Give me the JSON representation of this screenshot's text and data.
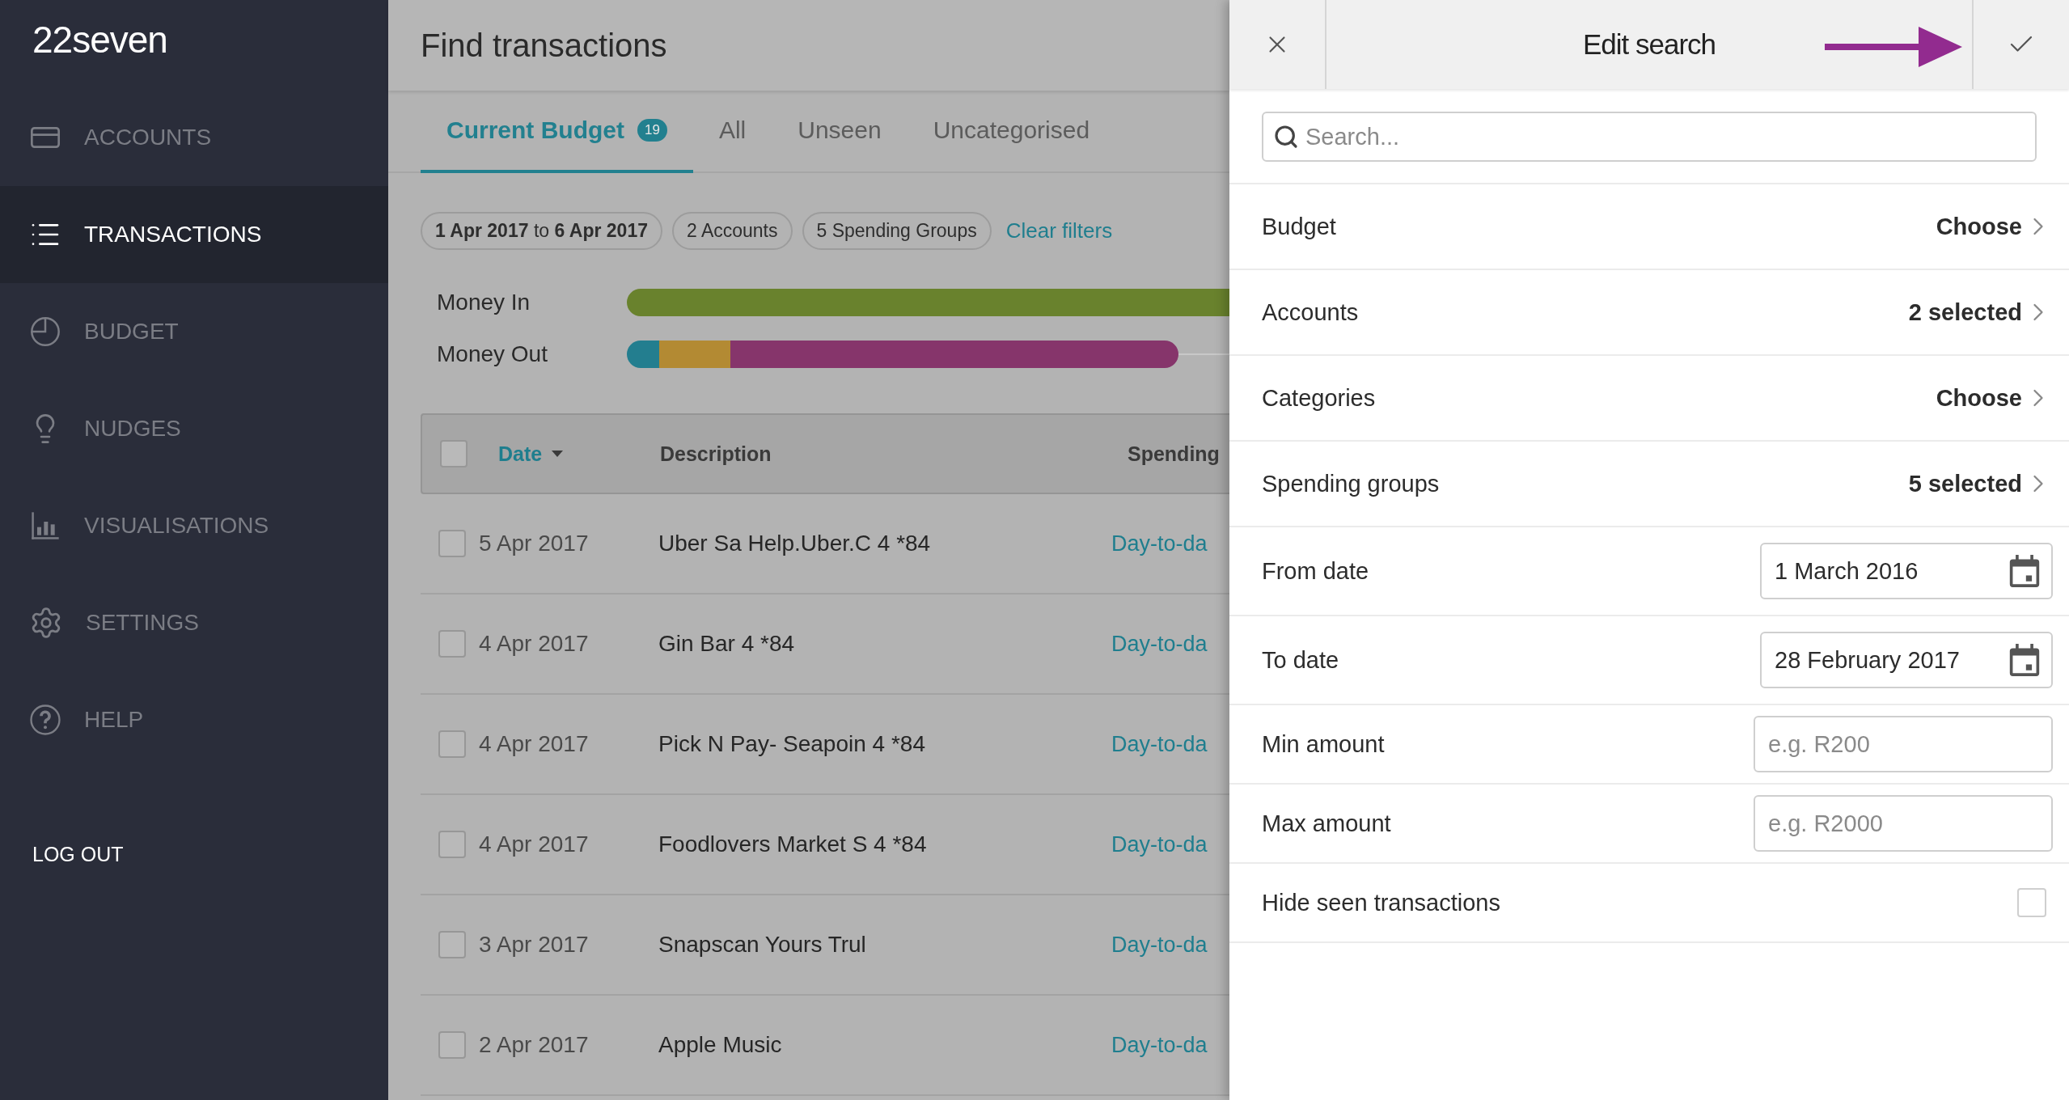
{
  "app": {
    "logo": "22seven"
  },
  "sidebar": {
    "items": [
      {
        "label": "ACCOUNTS",
        "kind": "card",
        "selected": false
      },
      {
        "label": "TRANSACTIONS",
        "kind": "list",
        "selected": true
      },
      {
        "label": "BUDGET",
        "kind": "pie",
        "selected": false
      },
      {
        "label": "NUDGES",
        "kind": "bulb",
        "selected": false
      },
      {
        "label": "VISUALISATIONS",
        "kind": "bars",
        "selected": false
      },
      {
        "label": "SETTINGS",
        "kind": "gear",
        "selected": false
      },
      {
        "label": "HELP",
        "kind": "help",
        "selected": false
      }
    ],
    "logout": "LOG OUT"
  },
  "page": {
    "title": "Find transactions",
    "tabs": [
      {
        "label": "Current Budget",
        "badge": "19",
        "selected": true
      },
      {
        "label": "All",
        "selected": false
      },
      {
        "label": "Unseen",
        "selected": false
      },
      {
        "label": "Uncategorised",
        "selected": false
      }
    ],
    "filters": [
      {
        "text": "**1 Apr 2017** to **6 Apr 2017**"
      },
      {
        "text": "2 Accounts"
      },
      {
        "text": "5 Spending Groups"
      }
    ],
    "clear_filters": "Clear filters",
    "flows": [
      {
        "label": "Money In",
        "kind": "in"
      },
      {
        "label": "Money Out",
        "kind": "out"
      }
    ],
    "table": {
      "all_checked": false,
      "columns": [
        {
          "label": "Date",
          "sorted": true
        },
        {
          "label": "Description",
          "sorted": false
        },
        {
          "label": "Spending",
          "sorted": false
        }
      ],
      "rows": [
        {
          "date": "5 Apr 2017",
          "description": "Uber Sa Help.Uber.C 4 *84",
          "group": "Day-to-da",
          "checked": false
        },
        {
          "date": "4 Apr 2017",
          "description": "Gin Bar 4 *84",
          "group": "Day-to-da",
          "checked": false
        },
        {
          "date": "4 Apr 2017",
          "description": "Pick N Pay- Seapoin 4 *84",
          "group": "Day-to-da",
          "checked": false
        },
        {
          "date": "4 Apr 2017",
          "description": "Foodlovers Market S 4 *84",
          "group": "Day-to-da",
          "checked": false
        },
        {
          "date": "3 Apr 2017",
          "description": "Snapscan Yours Trul",
          "group": "Day-to-da",
          "checked": false
        },
        {
          "date": "2 Apr 2017",
          "description": "Apple Music",
          "group": "Day-to-da",
          "checked": false
        }
      ]
    }
  },
  "panel": {
    "title": "Edit search",
    "search": {
      "placeholder": "Search..."
    },
    "rows": [
      {
        "kind": "choice",
        "label": "Budget",
        "value": "Choose"
      },
      {
        "kind": "choice",
        "label": "Accounts",
        "value": "2 selected"
      },
      {
        "kind": "choice",
        "label": "Categories",
        "value": "Choose"
      },
      {
        "kind": "choice",
        "label": "Spending groups",
        "value": "5 selected"
      },
      {
        "kind": "date",
        "label": "From date",
        "value": "1 March 2016"
      },
      {
        "kind": "date",
        "label": "To date",
        "value": "28 February 2017"
      },
      {
        "kind": "amount",
        "label": "Min amount",
        "placeholder": "e.g. R200"
      },
      {
        "kind": "amount",
        "label": "Max amount",
        "placeholder": "e.g. R2000"
      },
      {
        "kind": "checkbox",
        "label": "Hide seen transactions",
        "checked": false
      }
    ]
  }
}
